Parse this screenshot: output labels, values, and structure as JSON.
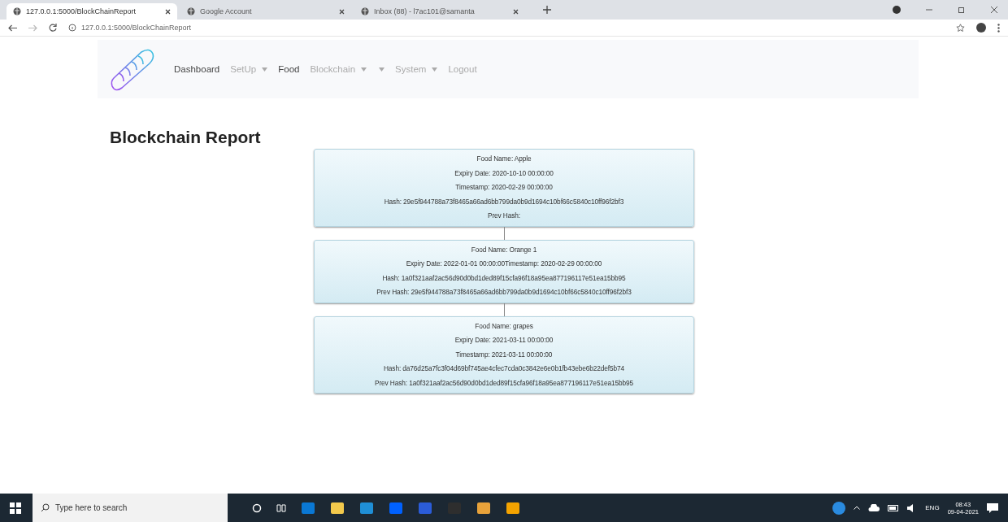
{
  "browser": {
    "tabs": [
      {
        "title": "127.0.0.1:5000/BlockChainReport",
        "selected": true
      },
      {
        "title": "Google Account",
        "selected": false
      },
      {
        "title": "Inbox (88) - l7ac101@samanta",
        "selected": false
      }
    ],
    "address": "127.0.0.1:5000/BlockChainReport"
  },
  "navbar": {
    "items": [
      {
        "label": "Dashboard",
        "dimmed": false,
        "dropdown": false
      },
      {
        "label": "SetUp",
        "dimmed": true,
        "dropdown": true
      },
      {
        "label": "Food",
        "dimmed": false,
        "dropdown": false
      },
      {
        "label": "Blockchain",
        "dimmed": true,
        "dropdown": true
      },
      {
        "dimmed": true,
        "dropdown": true
      },
      {
        "label": "System",
        "dimmed": true,
        "dropdown": true
      },
      {
        "label": "Logout",
        "dimmed": true,
        "dropdown": false
      }
    ]
  },
  "page": {
    "title": "Blockchain Report"
  },
  "blocks": [
    {
      "lines": [
        "Food Name: Apple",
        "Expiry Date: 2020-10-10 00:00:00",
        "Timestamp: 2020-02-29 00:00:00",
        "Hash: 29e5f944788a73f8465a66ad6bb799da0b9d1694c10bf66c5840c10ff96f2bf3",
        "Prev Hash:"
      ]
    },
    {
      "lines": [
        "Food Name: Orange 1",
        "Expiry Date: 2022-01-01 00:00:00Timestamp: 2020-02-29 00:00:00",
        "Hash: 1a0f321aaf2ac56d90d0bd1ded89f15cfa96f18a95ea877196117e51ea15bb95",
        "Prev Hash: 29e5f944788a73f8465a66ad6bb799da0b9d1694c10bf66c5840c10ff96f2bf3"
      ]
    },
    {
      "lines": [
        "Food Name: grapes",
        "Expiry Date: 2021-03-11 00:00:00",
        "Timestamp: 2021-03-11 00:00:00",
        "Hash: da76d25a7fc3f04d69bf745ae4cfec7cda0c3842e6e0b1fb43ebe6b22def5b74",
        "Prev Hash: 1a0f321aaf2ac56d90d0bd1ded89f15cfa96f18a95ea877196117e51ea15bb95"
      ]
    }
  ],
  "taskbar": {
    "search_placeholder": "Type here to search",
    "language": "ENG",
    "time": "08:43",
    "date": "09-04-2021"
  }
}
